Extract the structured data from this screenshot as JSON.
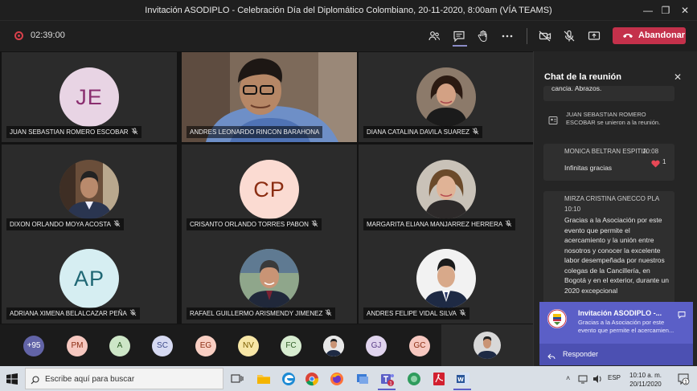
{
  "window": {
    "title": "Invitación ASODIPLO - Celebración Día del Diplomático Colombiano, 20-11-2020, 8:00am (VÍA TEAMS)",
    "min_glyph": "—",
    "max_glyph": "❐",
    "close_glyph": "✕"
  },
  "toolbar": {
    "timer": "02:39:00",
    "leave_label": "Abandonar"
  },
  "tiles": [
    {
      "type": "initials",
      "initials": "JE",
      "name": "JUAN SEBASTIAN ROMERO ESCOBAR",
      "bg": "#e8d4e4",
      "fg": "#8a2e6f"
    },
    {
      "type": "video",
      "name": "ANDRES LEONARDO RINCON BARAHONA"
    },
    {
      "type": "photo",
      "name": "DIANA CATALINA DAVILA SUAREZ"
    },
    {
      "type": "photo",
      "name": "DIXON ORLANDO MOYA ACOSTA"
    },
    {
      "type": "initials",
      "initials": "CP",
      "name": "CRISANTO ORLANDO TORRES PABON",
      "bg": "#fbdbd2",
      "fg": "#8b2d12"
    },
    {
      "type": "photo",
      "name": "MARGARITA ELIANA MANJARREZ HERRERA"
    },
    {
      "type": "initials",
      "initials": "AP",
      "name": "ADRIANA XIMENA BELALCAZAR PEÑA",
      "bg": "#d6eef2",
      "fg": "#1f6774"
    },
    {
      "type": "photo",
      "name": "RAFAEL GUILLERMO ARISMENDY JIMENEZ"
    },
    {
      "type": "photo",
      "name": "ANDRES FELIPE VIDAL SILVA"
    }
  ],
  "strip": [
    {
      "label": "+95",
      "bg": "#6264a7",
      "fg": "#ffffff"
    },
    {
      "label": "PM",
      "bg": "#f6c8c0",
      "fg": "#8b2d12"
    },
    {
      "label": "A",
      "bg": "#cde6c7",
      "fg": "#2f5d26"
    },
    {
      "label": "SC",
      "bg": "#d6daf2",
      "fg": "#3c4a8a"
    },
    {
      "label": "EG",
      "bg": "#f9cfc3",
      "fg": "#8b2d12"
    },
    {
      "label": "NV",
      "bg": "#f7e6a6",
      "fg": "#7a5c00"
    },
    {
      "label": "FC",
      "bg": "#d7ecd0",
      "fg": "#2f5d26"
    },
    {
      "label": "",
      "bg": "photo",
      "fg": ""
    },
    {
      "label": "GJ",
      "bg": "#e0d4ee",
      "fg": "#5a3d87"
    },
    {
      "label": "GC",
      "bg": "#f6c8c0",
      "fg": "#8b2d12"
    }
  ],
  "chat": {
    "title": "Chat de la reunión",
    "top_snippet": "cancia. Abrazos.",
    "join_event": "JUAN SEBASTIAN ROMERO ESCOBAR se unieron a la reunión.",
    "messages": [
      {
        "sender": "MONICA BELTRAN ESPITIA",
        "time": "10:08",
        "text": "Infinitas gracias",
        "reaction_count": "1"
      },
      {
        "sender": "MIRZA CRISTINA GNECCO PLA",
        "time": "10:10",
        "text": "Gracias a la Asociación por este evento que permite el acercamiento y la unión entre nosotros y conocer la excelente labor desempeñada por nuestros colegas de la Cancillería, en Bogotá y en el exterior, durante un 2020 excepcional"
      }
    ]
  },
  "notification": {
    "title": "Invitación ASODIPLO -...",
    "body": "Gracias a la Asociación por este evento que permite el acercamien...",
    "reply": "Responder"
  },
  "taskbar": {
    "search_placeholder": "Escribe aquí para buscar",
    "lang": "ESP",
    "time": "10:10 a. m.",
    "date": "20/11/2020",
    "badge": "1"
  },
  "colors": {
    "teams_purple": "#5b5fc7",
    "leave_red": "#c4314b"
  }
}
